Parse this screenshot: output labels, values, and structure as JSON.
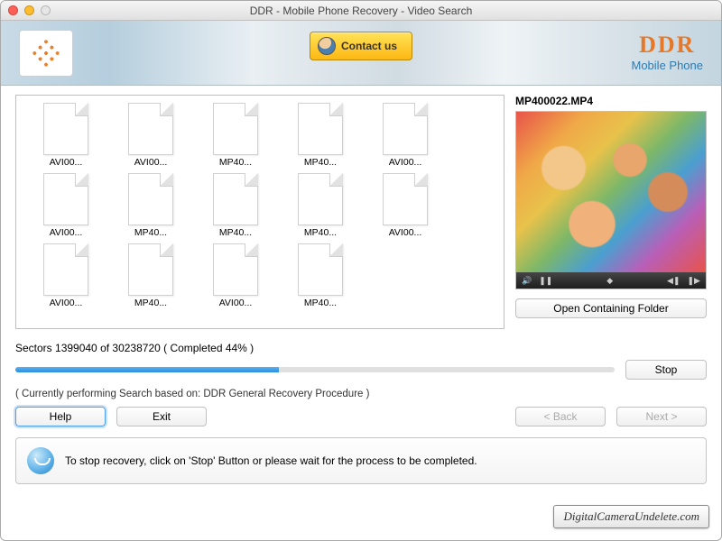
{
  "window": {
    "title": "DDR - Mobile Phone Recovery - Video Search"
  },
  "header": {
    "contact_label": "Contact us",
    "brand_main": "DDR",
    "brand_sub": "Mobile Phone"
  },
  "files": [
    {
      "name": "AVI00..."
    },
    {
      "name": "AVI00..."
    },
    {
      "name": "MP40..."
    },
    {
      "name": "MP40..."
    },
    {
      "name": "AVI00..."
    },
    {
      "name": "AVI00..."
    },
    {
      "name": "MP40..."
    },
    {
      "name": "MP40..."
    },
    {
      "name": "MP40..."
    },
    {
      "name": "AVI00..."
    },
    {
      "name": "AVI00..."
    },
    {
      "name": "MP40..."
    },
    {
      "name": "AVI00..."
    },
    {
      "name": "MP40..."
    }
  ],
  "preview": {
    "filename": "MP400022.MP4",
    "open_folder_label": "Open Containing Folder"
  },
  "progress": {
    "text": "Sectors 1399040 of 30238720   ( Completed 44% )",
    "percent": 44,
    "stop_label": "Stop",
    "search_info": "( Currently performing Search based on: DDR General Recovery Procedure )"
  },
  "buttons": {
    "help": "Help",
    "exit": "Exit",
    "back": "< Back",
    "next": "Next >"
  },
  "info": {
    "text": "To stop recovery, click on 'Stop' Button or please wait for the process to be completed."
  },
  "watermark": "DigitalCameraUndelete.com"
}
